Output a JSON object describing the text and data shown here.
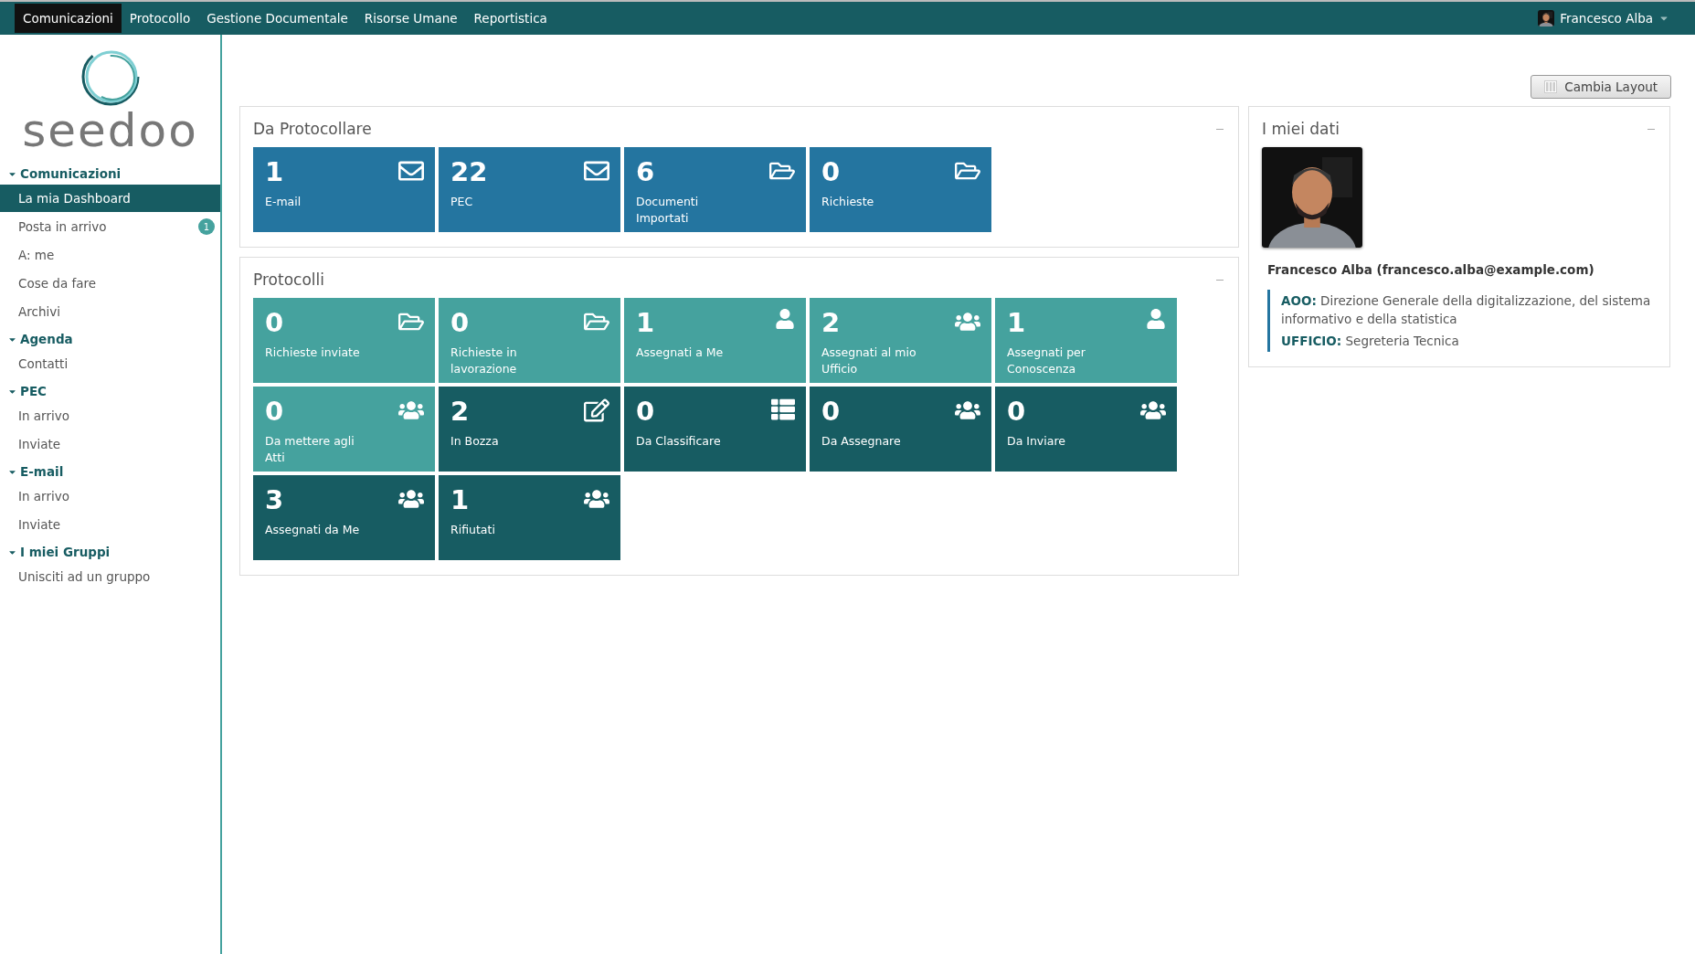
{
  "topbar": {
    "menu": [
      {
        "label": "Comunicazioni",
        "selected": true
      },
      {
        "label": "Protocollo",
        "selected": false
      },
      {
        "label": "Gestione Documentale",
        "selected": false
      },
      {
        "label": "Risorse Umane",
        "selected": false
      },
      {
        "label": "Reportistica",
        "selected": false
      }
    ],
    "user": {
      "name": "Francesco Alba"
    }
  },
  "sidebar": {
    "logo": "seedoo",
    "groups": [
      {
        "title": "Comunicazioni",
        "expanded": true,
        "items": [
          {
            "label": "La mia Dashboard",
            "selected": true
          },
          {
            "label": "Posta in arrivo",
            "selected": false,
            "badge": "1"
          },
          {
            "label": "A: me",
            "selected": false
          },
          {
            "label": "Cose da fare",
            "selected": false
          },
          {
            "label": "Archivi",
            "selected": false
          }
        ]
      },
      {
        "title": "Agenda",
        "expanded": true,
        "items": [
          {
            "label": "Contatti",
            "selected": false
          }
        ]
      },
      {
        "title": "PEC",
        "expanded": true,
        "items": [
          {
            "label": "In arrivo",
            "selected": false
          },
          {
            "label": "Inviate",
            "selected": false
          }
        ]
      },
      {
        "title": "E-mail",
        "expanded": true,
        "items": [
          {
            "label": "In arrivo",
            "selected": false
          },
          {
            "label": "Inviate",
            "selected": false
          }
        ]
      },
      {
        "title": "I miei Gruppi",
        "expanded": true,
        "items": [
          {
            "label": "Unisciti ad un gruppo",
            "selected": false
          }
        ]
      }
    ]
  },
  "layout_button": "Cambia Layout",
  "panels": [
    {
      "title": "Da Protocollare",
      "tiles": [
        {
          "count": "1",
          "label": "E-mail",
          "color": "#2475a0",
          "kind": "envelope"
        },
        {
          "count": "22",
          "label": "PEC",
          "color": "#2475a0",
          "kind": "envelope"
        },
        {
          "count": "6",
          "label": "Documenti Importati",
          "color": "#2475a0",
          "kind": "folder"
        },
        {
          "count": "0",
          "label": "Richieste",
          "color": "#2475a0",
          "kind": "folder"
        }
      ]
    },
    {
      "title": "Protocolli",
      "tiles": [
        {
          "count": "0",
          "label": "Richieste inviate",
          "color": "#45a29e",
          "kind": "folder"
        },
        {
          "count": "0",
          "label": "Richieste in lavorazione",
          "color": "#45a29e",
          "kind": "folder"
        },
        {
          "count": "1",
          "label": "Assegnati a Me",
          "color": "#45a29e",
          "kind": "user"
        },
        {
          "count": "2",
          "label": "Assegnati al mio Ufficio",
          "color": "#45a29e",
          "kind": "users"
        },
        {
          "count": "1",
          "label": "Assegnati per Conoscenza",
          "color": "#45a29e",
          "kind": "user"
        },
        {
          "count": "0",
          "label": "Da mettere agli Atti",
          "color": "#45a29e",
          "kind": "users"
        },
        {
          "count": "2",
          "label": "In Bozza",
          "color": "#175c62",
          "kind": "edit"
        },
        {
          "count": "0",
          "label": "Da Classificare",
          "color": "#175c62",
          "kind": "list"
        },
        {
          "count": "0",
          "label": "Da Assegnare",
          "color": "#175c62",
          "kind": "users"
        },
        {
          "count": "0",
          "label": "Da Inviare",
          "color": "#175c62",
          "kind": "users"
        },
        {
          "count": "3",
          "label": "Assegnati da Me",
          "color": "#175c62",
          "kind": "users"
        },
        {
          "count": "1",
          "label": "Rifiutati",
          "color": "#175c62",
          "kind": "users"
        }
      ]
    }
  ],
  "profile": {
    "title": "I miei dati",
    "identity": "Francesco Alba (francesco.alba@example.com)",
    "details": [
      "**AOO:** Direzione Generale della digitalizzazione, del sistema informativo e della statistica",
      "**UFFICIO:** Segreteria Tecnica"
    ]
  }
}
